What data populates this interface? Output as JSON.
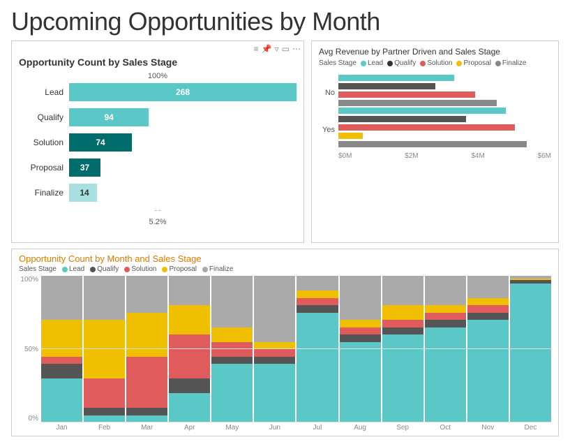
{
  "title": "Upcoming Opportunities by Month",
  "top_left": {
    "title": "Opportunity Count by Sales Stage",
    "subtitle_percent": "100%",
    "bars": [
      {
        "label": "Lead",
        "value": 268,
        "pct": 100,
        "color": "#5bc8c8",
        "show_value": true,
        "outside": false
      },
      {
        "label": "Qualify",
        "value": 94,
        "pct": 34,
        "color": "#5bc8c8",
        "show_value": true,
        "outside": false
      },
      {
        "label": "Solution",
        "value": 74,
        "pct": 27,
        "color": "#006d6d",
        "show_value": true,
        "outside": false
      },
      {
        "label": "Proposal",
        "value": 37,
        "pct": 14,
        "color": "#006d6d",
        "show_value": true,
        "outside": false
      },
      {
        "label": "Finalize",
        "value": 14,
        "pct": 5.2,
        "color": "#a8e0e0",
        "show_value": true,
        "outside": true
      }
    ],
    "note": "5.2%"
  },
  "top_right": {
    "title": "Avg Revenue by Partner Driven and Sales Stage",
    "legend_label": "Sales Stage",
    "legend_items": [
      {
        "label": "Lead",
        "color": "#5bc8c8"
      },
      {
        "label": "Qualify",
        "color": "#333333"
      },
      {
        "label": "Solution",
        "color": "#e05c5c"
      },
      {
        "label": "Proposal",
        "color": "#f0c000"
      },
      {
        "label": "Finalize",
        "color": "#888888"
      }
    ],
    "groups": [
      {
        "label": "No",
        "bars": [
          {
            "label": "Lead",
            "value": 3.8,
            "color": "#5bc8c8"
          },
          {
            "label": "Qualify",
            "color": "#555",
            "value": 3.2
          },
          {
            "label": "Solution",
            "color": "#e05c5c",
            "value": 4.5
          },
          {
            "label": "Proposal",
            "color": "#f0c000",
            "value": 0
          },
          {
            "label": "Finalize",
            "color": "#888888",
            "value": 5.2
          }
        ]
      },
      {
        "label": "Yes",
        "bars": [
          {
            "label": "Lead",
            "value": 5.5,
            "color": "#5bc8c8"
          },
          {
            "label": "Qualify",
            "color": "#555",
            "value": 4.2
          },
          {
            "label": "Solution",
            "color": "#e05c5c",
            "value": 5.8
          },
          {
            "label": "Proposal",
            "color": "#f0c000",
            "value": 0.8
          },
          {
            "label": "Finalize",
            "color": "#888888",
            "value": 6.2
          }
        ]
      }
    ],
    "x_axis": [
      "$0M",
      "$2M",
      "$4M",
      "$6M"
    ]
  },
  "bottom": {
    "title": "Opportunity Count by Month and Sales Stage",
    "legend_label": "Sales Stage",
    "legend_items": [
      {
        "label": "Lead",
        "color": "#5bc8c8"
      },
      {
        "label": "Qualify",
        "color": "#555555"
      },
      {
        "label": "Solution",
        "color": "#e05c5c"
      },
      {
        "label": "Proposal",
        "color": "#f0c000"
      },
      {
        "label": "Finalize",
        "color": "#aaaaaa"
      }
    ],
    "y_labels": [
      "100%",
      "50%",
      "0%"
    ],
    "months": [
      "Jan",
      "Feb",
      "Mar",
      "Apr",
      "May",
      "Jun",
      "Jul",
      "Aug",
      "Sep",
      "Oct",
      "Nov",
      "Dec"
    ],
    "data": {
      "Jan": {
        "lead": 30,
        "qualify": 10,
        "solution": 5,
        "proposal": 25,
        "finalize": 30
      },
      "Feb": {
        "lead": 5,
        "qualify": 5,
        "solution": 20,
        "proposal": 40,
        "finalize": 30
      },
      "Mar": {
        "lead": 5,
        "qualify": 5,
        "solution": 35,
        "proposal": 30,
        "finalize": 25
      },
      "Apr": {
        "lead": 20,
        "qualify": 10,
        "solution": 30,
        "proposal": 20,
        "finalize": 20
      },
      "May": {
        "lead": 40,
        "qualify": 5,
        "solution": 10,
        "proposal": 10,
        "finalize": 35
      },
      "Jun": {
        "lead": 40,
        "qualify": 5,
        "solution": 5,
        "proposal": 5,
        "finalize": 45
      },
      "Jul": {
        "lead": 75,
        "qualify": 5,
        "solution": 5,
        "proposal": 5,
        "finalize": 10
      },
      "Aug": {
        "lead": 55,
        "qualify": 5,
        "solution": 5,
        "proposal": 5,
        "finalize": 30
      },
      "Sep": {
        "lead": 60,
        "qualify": 5,
        "solution": 5,
        "proposal": 10,
        "finalize": 20
      },
      "Oct": {
        "lead": 65,
        "qualify": 5,
        "solution": 5,
        "proposal": 5,
        "finalize": 20
      },
      "Nov": {
        "lead": 70,
        "qualify": 5,
        "solution": 5,
        "proposal": 5,
        "finalize": 15
      },
      "Dec": {
        "lead": 95,
        "qualify": 2,
        "solution": 0,
        "proposal": 1,
        "finalize": 2
      }
    }
  },
  "colors": {
    "lead": "#5bc8c8",
    "qualify": "#555555",
    "solution": "#e05c5c",
    "proposal": "#f0c000",
    "finalize": "#aaaaaa"
  }
}
